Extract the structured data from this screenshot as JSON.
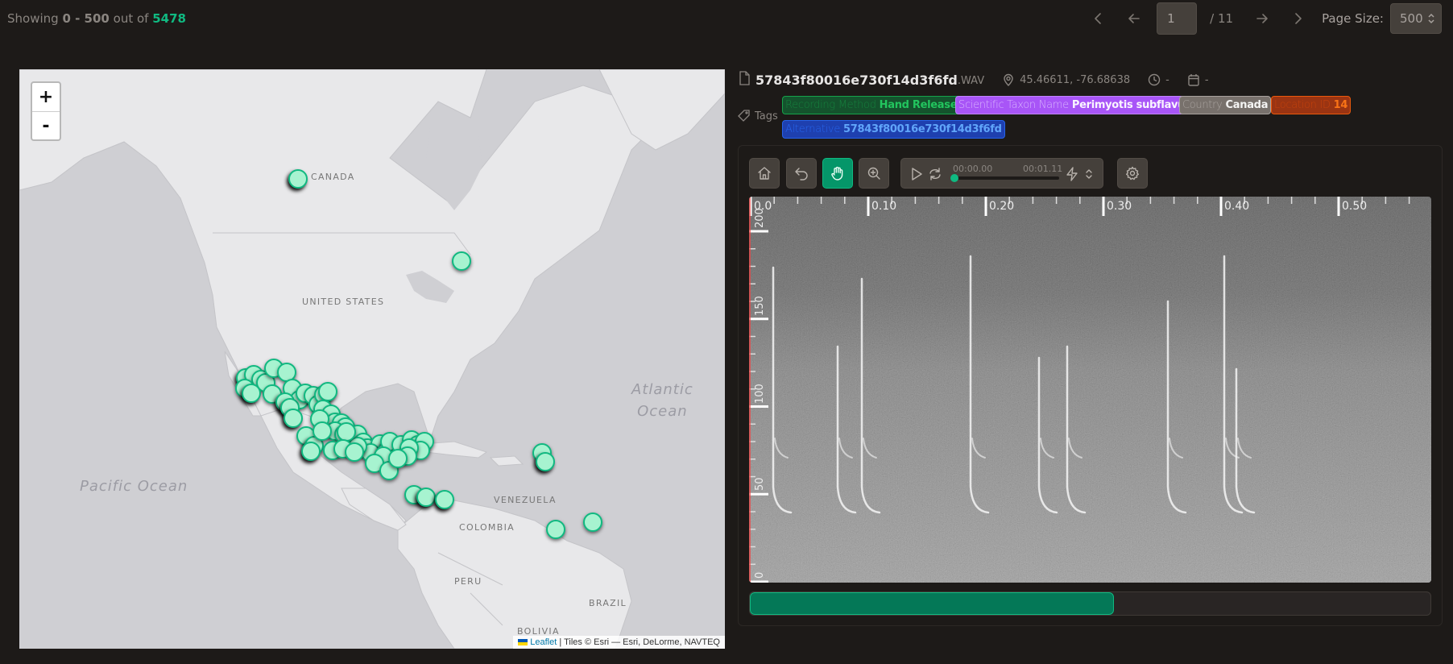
{
  "header": {
    "showing_prefix": "Showing",
    "range": "0 - 500",
    "out_of_label": "out of",
    "total": "5478"
  },
  "pagination": {
    "first_icon": "chevron-left-icon",
    "prev_icon": "arrow-left-icon",
    "current_page": "1",
    "total_pages_label": "/ 11",
    "next_icon": "arrow-right-icon",
    "last_icon": "chevron-right-icon",
    "page_size_label": "Page Size:",
    "page_size": "500"
  },
  "map": {
    "zoom_in": "+",
    "zoom_out": "-",
    "labels": {
      "canada": "CANADA",
      "united_states": "UNITED STATES",
      "venezuela": "VENEZUELA",
      "colombia": "COLOMBIA",
      "peru": "PERU",
      "brazil": "BRAZIL",
      "bolivia": "BOLIVIA",
      "atlantic_1": "Atlantic",
      "atlantic_2": "Ocean",
      "pacific": "Pacific Ocean"
    },
    "attribution": {
      "leaflet": "Leaflet",
      "tiles": "| Tiles © Esri — Esri, DeLorme, NAVTEQ"
    },
    "marker_color": "#a7f3d0",
    "marker_border": "#10b981"
  },
  "recording": {
    "file_icon": "file-icon",
    "file_name": "57843f80016e730f14d3f6fd",
    "file_ext": ".WAV",
    "coordinates": "45.46611, -76.68638",
    "time": "-",
    "date": "-",
    "tags_label": "Tags",
    "tags": [
      {
        "key": "Recording Method",
        "value": "Hand Release",
        "color": "green"
      },
      {
        "key": "Scientific Taxon Name",
        "value": "Perimyotis subflavus",
        "color": "purple"
      },
      {
        "key": "Country",
        "value": "Canada",
        "color": "gray"
      },
      {
        "key": "Location ID",
        "value": "14",
        "color": "orange"
      },
      {
        "key": "Alternative",
        "value": "57843f80016e730f14d3f6fd",
        "color": "blue"
      }
    ]
  },
  "toolbar": {
    "home_icon": "home-icon",
    "undo_icon": "undo-icon",
    "pan_icon": "hand-icon",
    "zoom_icon": "zoom-in-icon",
    "settings_icon": "gear-icon",
    "pan_active": true,
    "player": {
      "current_time": "00:00.00",
      "duration": "00:01.11",
      "position_fraction": 0.0
    }
  },
  "spectrogram": {
    "x_ticks": [
      "0.0",
      "0.10",
      "0.20",
      "0.30",
      "0.40",
      "0.50"
    ],
    "y_ticks": [
      "200",
      "150",
      "100",
      "50",
      "0"
    ],
    "accent_line_color": "#ef4444"
  },
  "progress": {
    "fraction": 0.535,
    "color": "#047857"
  }
}
